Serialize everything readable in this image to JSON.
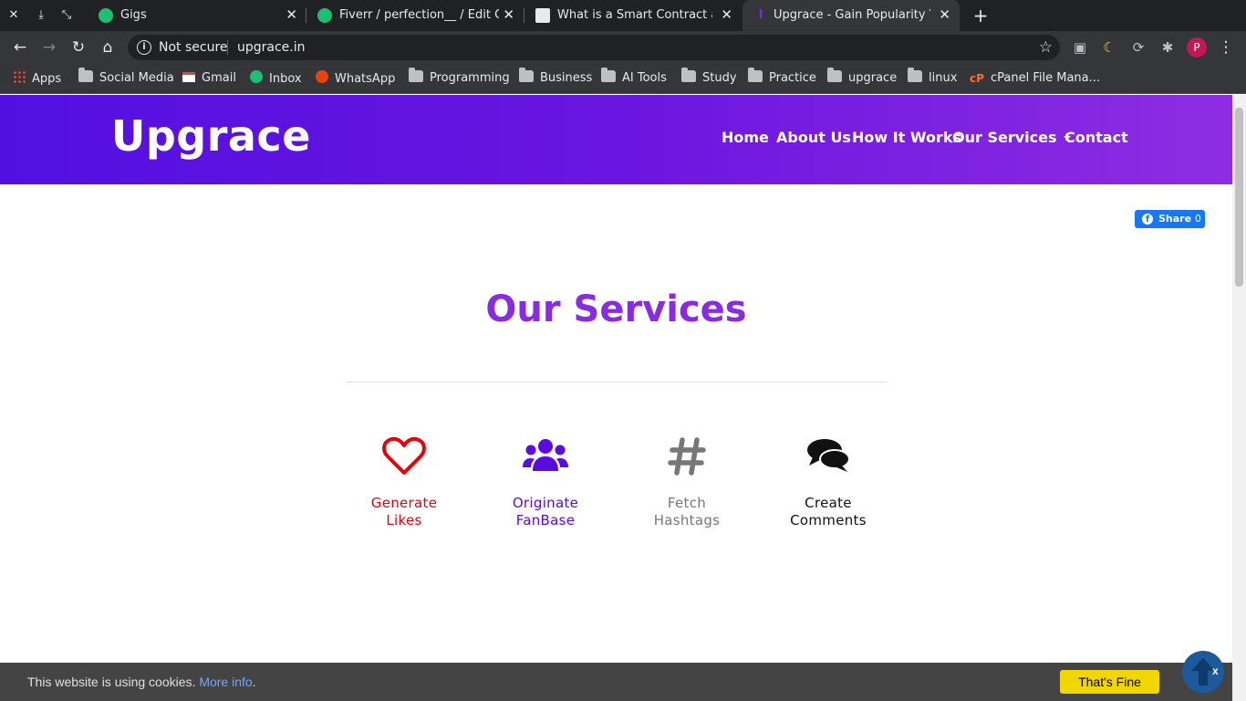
{
  "browser": {
    "tabs": [
      {
        "title": "Gigs",
        "active": false
      },
      {
        "title": "Fiverr / perfection__ / Edit Gig",
        "active": false
      },
      {
        "title": "What is a Smart Contract and",
        "active": false
      },
      {
        "title": "Upgrace - Gain Popularity Via",
        "active": true
      }
    ],
    "omnibox": {
      "security": "Not secure",
      "url": "upgrace.in"
    },
    "profile_initial": "P",
    "bookmarks": [
      "Apps",
      "Social Media",
      "Gmail",
      "Inbox",
      "WhatsApp",
      "Programming",
      "Business",
      "AI Tools",
      "Study",
      "Practice",
      "upgrace",
      "linux",
      "cPanel File Mana..."
    ]
  },
  "site": {
    "logo": "Upgrace",
    "nav": [
      "Home",
      "About Us",
      "How It Works",
      "Our Services",
      "Contact"
    ],
    "fb_share": {
      "label": "Share",
      "count": "0"
    },
    "section_title": "Our Services",
    "services": [
      {
        "line1": "Generate",
        "line2": "Likes",
        "icon": "heart-icon",
        "color": "#e8000b"
      },
      {
        "line1": "Originate",
        "line2": "FanBase",
        "icon": "users-icon",
        "color": "#5a0be0"
      },
      {
        "line1": "Fetch",
        "line2": "Hashtags",
        "icon": "hashtag-icon",
        "color": "#777777"
      },
      {
        "line1": "Create",
        "line2": "Comments",
        "icon": "comments-icon",
        "color": "#111111"
      }
    ],
    "cookie": {
      "text": "This website is using cookies.",
      "link": "More info",
      "after": ".",
      "button": "That's Fine"
    },
    "close_mark": "x"
  },
  "colors": {
    "hero_start": "#5210e0",
    "hero_end": "#8e2de2",
    "title": "#8a2be2",
    "cookie_button": "#f1d600"
  }
}
